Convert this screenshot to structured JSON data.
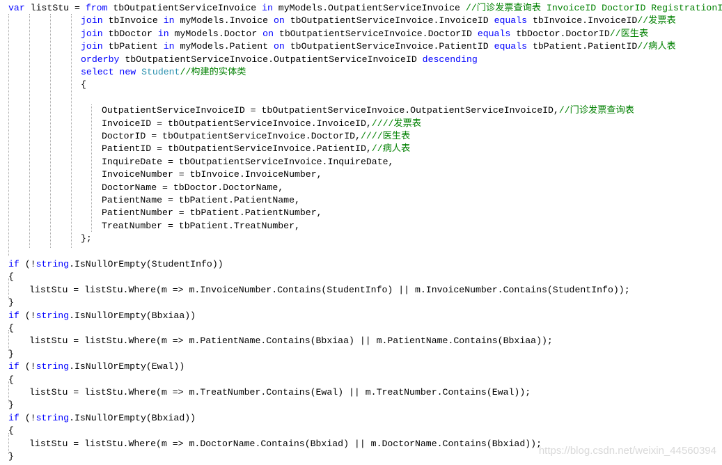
{
  "editor": {
    "language": "C#",
    "colors": {
      "keyword": "#0000ff",
      "type": "#2b91af",
      "comment": "#008000",
      "text": "#000000",
      "guide": "#a8a8a8"
    },
    "lines": [
      {
        "indent": 0,
        "tokens": [
          [
            "kw",
            "var"
          ],
          [
            "tx",
            " listStu = "
          ],
          [
            "kw",
            "from"
          ],
          [
            "tx",
            " tbOutpatientServiceInvoice "
          ],
          [
            "kw",
            "in"
          ],
          [
            "tx",
            " myModels.OutpatientServiceInvoice "
          ],
          [
            "cm",
            "//门诊发票查询表 InvoiceID DoctorID RegistrationID  Pat"
          ]
        ]
      },
      {
        "indent": 1,
        "tokens": [
          [
            "kw",
            "join"
          ],
          [
            "tx",
            " tbInvoice "
          ],
          [
            "kw",
            "in"
          ],
          [
            "tx",
            " myModels.Invoice "
          ],
          [
            "kw",
            "on"
          ],
          [
            "tx",
            " tbOutpatientServiceInvoice.InvoiceID "
          ],
          [
            "kw",
            "equals"
          ],
          [
            "tx",
            " tbInvoice.InvoiceID"
          ],
          [
            "cm",
            "//发票表"
          ]
        ]
      },
      {
        "indent": 1,
        "tokens": [
          [
            "kw",
            "join"
          ],
          [
            "tx",
            " tbDoctor "
          ],
          [
            "kw",
            "in"
          ],
          [
            "tx",
            " myModels.Doctor "
          ],
          [
            "kw",
            "on"
          ],
          [
            "tx",
            " tbOutpatientServiceInvoice.DoctorID "
          ],
          [
            "kw",
            "equals"
          ],
          [
            "tx",
            " tbDoctor.DoctorID"
          ],
          [
            "cm",
            "//医生表"
          ]
        ]
      },
      {
        "indent": 1,
        "tokens": [
          [
            "kw",
            "join"
          ],
          [
            "tx",
            " tbPatient "
          ],
          [
            "kw",
            "in"
          ],
          [
            "tx",
            " myModels.Patient "
          ],
          [
            "kw",
            "on"
          ],
          [
            "tx",
            " tbOutpatientServiceInvoice.PatientID "
          ],
          [
            "kw",
            "equals"
          ],
          [
            "tx",
            " tbPatient.PatientID"
          ],
          [
            "cm",
            "//病人表"
          ]
        ]
      },
      {
        "indent": 1,
        "tokens": [
          [
            "kw",
            "orderby"
          ],
          [
            "tx",
            " tbOutpatientServiceInvoice.OutpatientServiceInvoiceID "
          ],
          [
            "kw",
            "descending"
          ]
        ]
      },
      {
        "indent": 1,
        "tokens": [
          [
            "kw",
            "select"
          ],
          [
            "tx",
            " "
          ],
          [
            "kw",
            "new"
          ],
          [
            "tx",
            " "
          ],
          [
            "type",
            "Student"
          ],
          [
            "cm",
            "//构建的实体类"
          ]
        ]
      },
      {
        "indent": 1,
        "tokens": [
          [
            "tx",
            "{"
          ]
        ]
      },
      {
        "indent": 1,
        "tokens": []
      },
      {
        "indent": 2,
        "tokens": [
          [
            "tx",
            "OutpatientServiceInvoiceID = tbOutpatientServiceInvoice.OutpatientServiceInvoiceID,"
          ],
          [
            "cm",
            "//门诊发票查询表"
          ]
        ]
      },
      {
        "indent": 2,
        "tokens": [
          [
            "tx",
            "InvoiceID = tbOutpatientServiceInvoice.InvoiceID,"
          ],
          [
            "cm",
            "////发票表"
          ]
        ]
      },
      {
        "indent": 2,
        "tokens": [
          [
            "tx",
            "DoctorID = tbOutpatientServiceInvoice.DoctorID,"
          ],
          [
            "cm",
            "////医生表"
          ]
        ]
      },
      {
        "indent": 2,
        "tokens": [
          [
            "tx",
            "PatientID = tbOutpatientServiceInvoice.PatientID,"
          ],
          [
            "cm",
            "//病人表"
          ]
        ]
      },
      {
        "indent": 2,
        "tokens": [
          [
            "tx",
            "InquireDate = tbOutpatientServiceInvoice.InquireDate,"
          ]
        ]
      },
      {
        "indent": 2,
        "tokens": [
          [
            "tx",
            "InvoiceNumber = tbInvoice.InvoiceNumber,"
          ]
        ]
      },
      {
        "indent": 2,
        "tokens": [
          [
            "tx",
            "DoctorName = tbDoctor.DoctorName,"
          ]
        ]
      },
      {
        "indent": 2,
        "tokens": [
          [
            "tx",
            "PatientName = tbPatient.PatientName,"
          ]
        ]
      },
      {
        "indent": 2,
        "tokens": [
          [
            "tx",
            "PatientNumber = tbPatient.PatientNumber,"
          ]
        ]
      },
      {
        "indent": 2,
        "tokens": [
          [
            "tx",
            "TreatNumber = tbPatient.TreatNumber,"
          ]
        ]
      },
      {
        "indent": 1,
        "tokens": [
          [
            "tx",
            "};"
          ]
        ]
      },
      {
        "indent": 0,
        "tokens": []
      },
      {
        "indent": 0,
        "tokens": [
          [
            "kw",
            "if"
          ],
          [
            "tx",
            " (!"
          ],
          [
            "kw",
            "string"
          ],
          [
            "tx",
            ".IsNullOrEmpty(StudentInfo))"
          ]
        ]
      },
      {
        "indent": 0,
        "tokens": [
          [
            "tx",
            "{"
          ]
        ]
      },
      {
        "indent": 3,
        "tokens": [
          [
            "tx",
            "listStu = listStu.Where(m => m.InvoiceNumber.Contains(StudentInfo) || m.InvoiceNumber.Contains(StudentInfo));"
          ]
        ]
      },
      {
        "indent": 0,
        "tokens": [
          [
            "tx",
            "}"
          ]
        ]
      },
      {
        "indent": 0,
        "tokens": [
          [
            "kw",
            "if"
          ],
          [
            "tx",
            " (!"
          ],
          [
            "kw",
            "string"
          ],
          [
            "tx",
            ".IsNullOrEmpty(Bbxiaa))"
          ]
        ]
      },
      {
        "indent": 0,
        "tokens": [
          [
            "tx",
            "{"
          ]
        ]
      },
      {
        "indent": 3,
        "tokens": [
          [
            "tx",
            "listStu = listStu.Where(m => m.PatientName.Contains(Bbxiaa) || m.PatientName.Contains(Bbxiaa));"
          ]
        ]
      },
      {
        "indent": 0,
        "tokens": [
          [
            "tx",
            "}"
          ]
        ]
      },
      {
        "indent": 0,
        "tokens": [
          [
            "kw",
            "if"
          ],
          [
            "tx",
            " (!"
          ],
          [
            "kw",
            "string"
          ],
          [
            "tx",
            ".IsNullOrEmpty(Ewal))"
          ]
        ]
      },
      {
        "indent": 0,
        "tokens": [
          [
            "tx",
            "{"
          ]
        ]
      },
      {
        "indent": 3,
        "tokens": [
          [
            "tx",
            "listStu = listStu.Where(m => m.TreatNumber.Contains(Ewal) || m.TreatNumber.Contains(Ewal));"
          ]
        ]
      },
      {
        "indent": 0,
        "tokens": [
          [
            "tx",
            "}"
          ]
        ]
      },
      {
        "indent": 0,
        "tokens": [
          [
            "kw",
            "if"
          ],
          [
            "tx",
            " (!"
          ],
          [
            "kw",
            "string"
          ],
          [
            "tx",
            ".IsNullOrEmpty(Bbxiad))"
          ]
        ]
      },
      {
        "indent": 0,
        "tokens": [
          [
            "tx",
            "{"
          ]
        ]
      },
      {
        "indent": 3,
        "tokens": [
          [
            "tx",
            "listStu = listStu.Where(m => m.DoctorName.Contains(Bbxiad) || m.DoctorName.Contains(Bbxiad));"
          ]
        ]
      },
      {
        "indent": 0,
        "tokens": [
          [
            "tx",
            "}"
          ]
        ]
      }
    ]
  },
  "watermark": "https://blog.csdn.net/weixin_44560394"
}
